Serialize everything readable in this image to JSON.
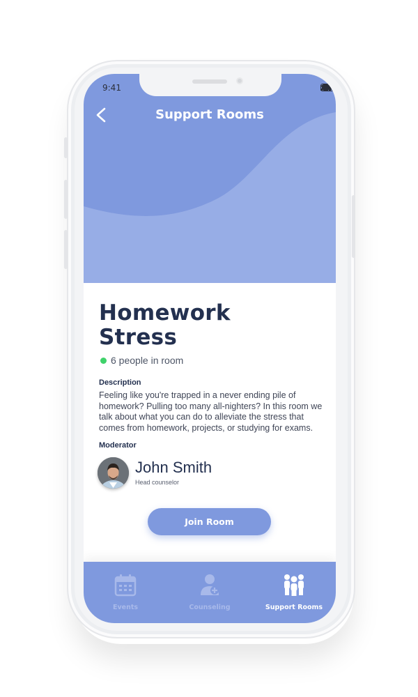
{
  "status_bar": {
    "time": "9:41"
  },
  "header": {
    "title": "Support Rooms",
    "back_icon": "chevron-left-icon"
  },
  "room": {
    "title_line1": "Homework",
    "title_line2": "Stress",
    "people_count": "6 people in room",
    "online_color": "#3fd26a",
    "description_label": "Description",
    "description": "Feeling like you're trapped in a never ending pile of homework? Pulling too many all-nighters? In this room we talk about what you can do to alleviate the stress that comes from homework, projects, or studying for exams.",
    "moderator_label": "Moderator",
    "moderator_name": "John Smith",
    "moderator_role": "Head counselor",
    "join_label": "Join Room"
  },
  "tabs": [
    {
      "label": "Events",
      "icon": "calendar-icon",
      "active": false
    },
    {
      "label": "Counseling",
      "icon": "person-plus-icon",
      "active": false
    },
    {
      "label": "Support Rooms",
      "icon": "group-icon",
      "active": true
    }
  ],
  "colors": {
    "accent": "#7f99de",
    "title_text": "#23304f",
    "inactive_tab": "#a8b9ea"
  }
}
